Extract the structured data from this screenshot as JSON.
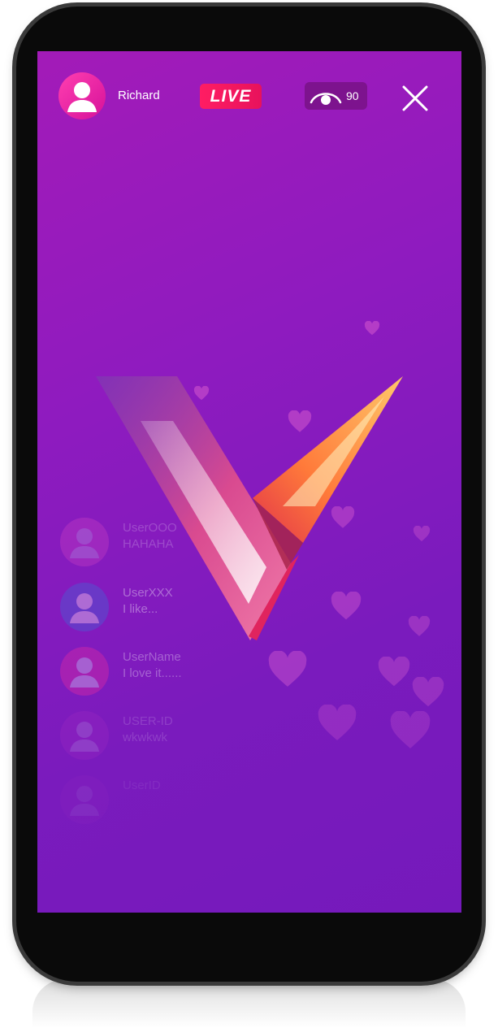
{
  "stream": {
    "host_name": "Richard",
    "live_label": "LIVE",
    "viewer_count": "90"
  },
  "comments": [
    {
      "user": "UserOOO",
      "text": "HAHAHA"
    },
    {
      "user": "UserXXX",
      "text": "I like..."
    },
    {
      "user": "UserName",
      "text": "I love it......"
    },
    {
      "user": "USER-ID",
      "text": "wkwkwk"
    },
    {
      "user": "UserID",
      "text": ""
    }
  ],
  "colors": {
    "background_top": "#a31bb8",
    "background_bottom": "#7519bb",
    "live_badge": "#ff1d63",
    "avatar": "#ff3fb0",
    "viewer_badge": "#7d138e"
  },
  "icons": [
    "user-avatar-icon",
    "eye-icon",
    "close-icon",
    "heart-icon",
    "v-logo"
  ]
}
